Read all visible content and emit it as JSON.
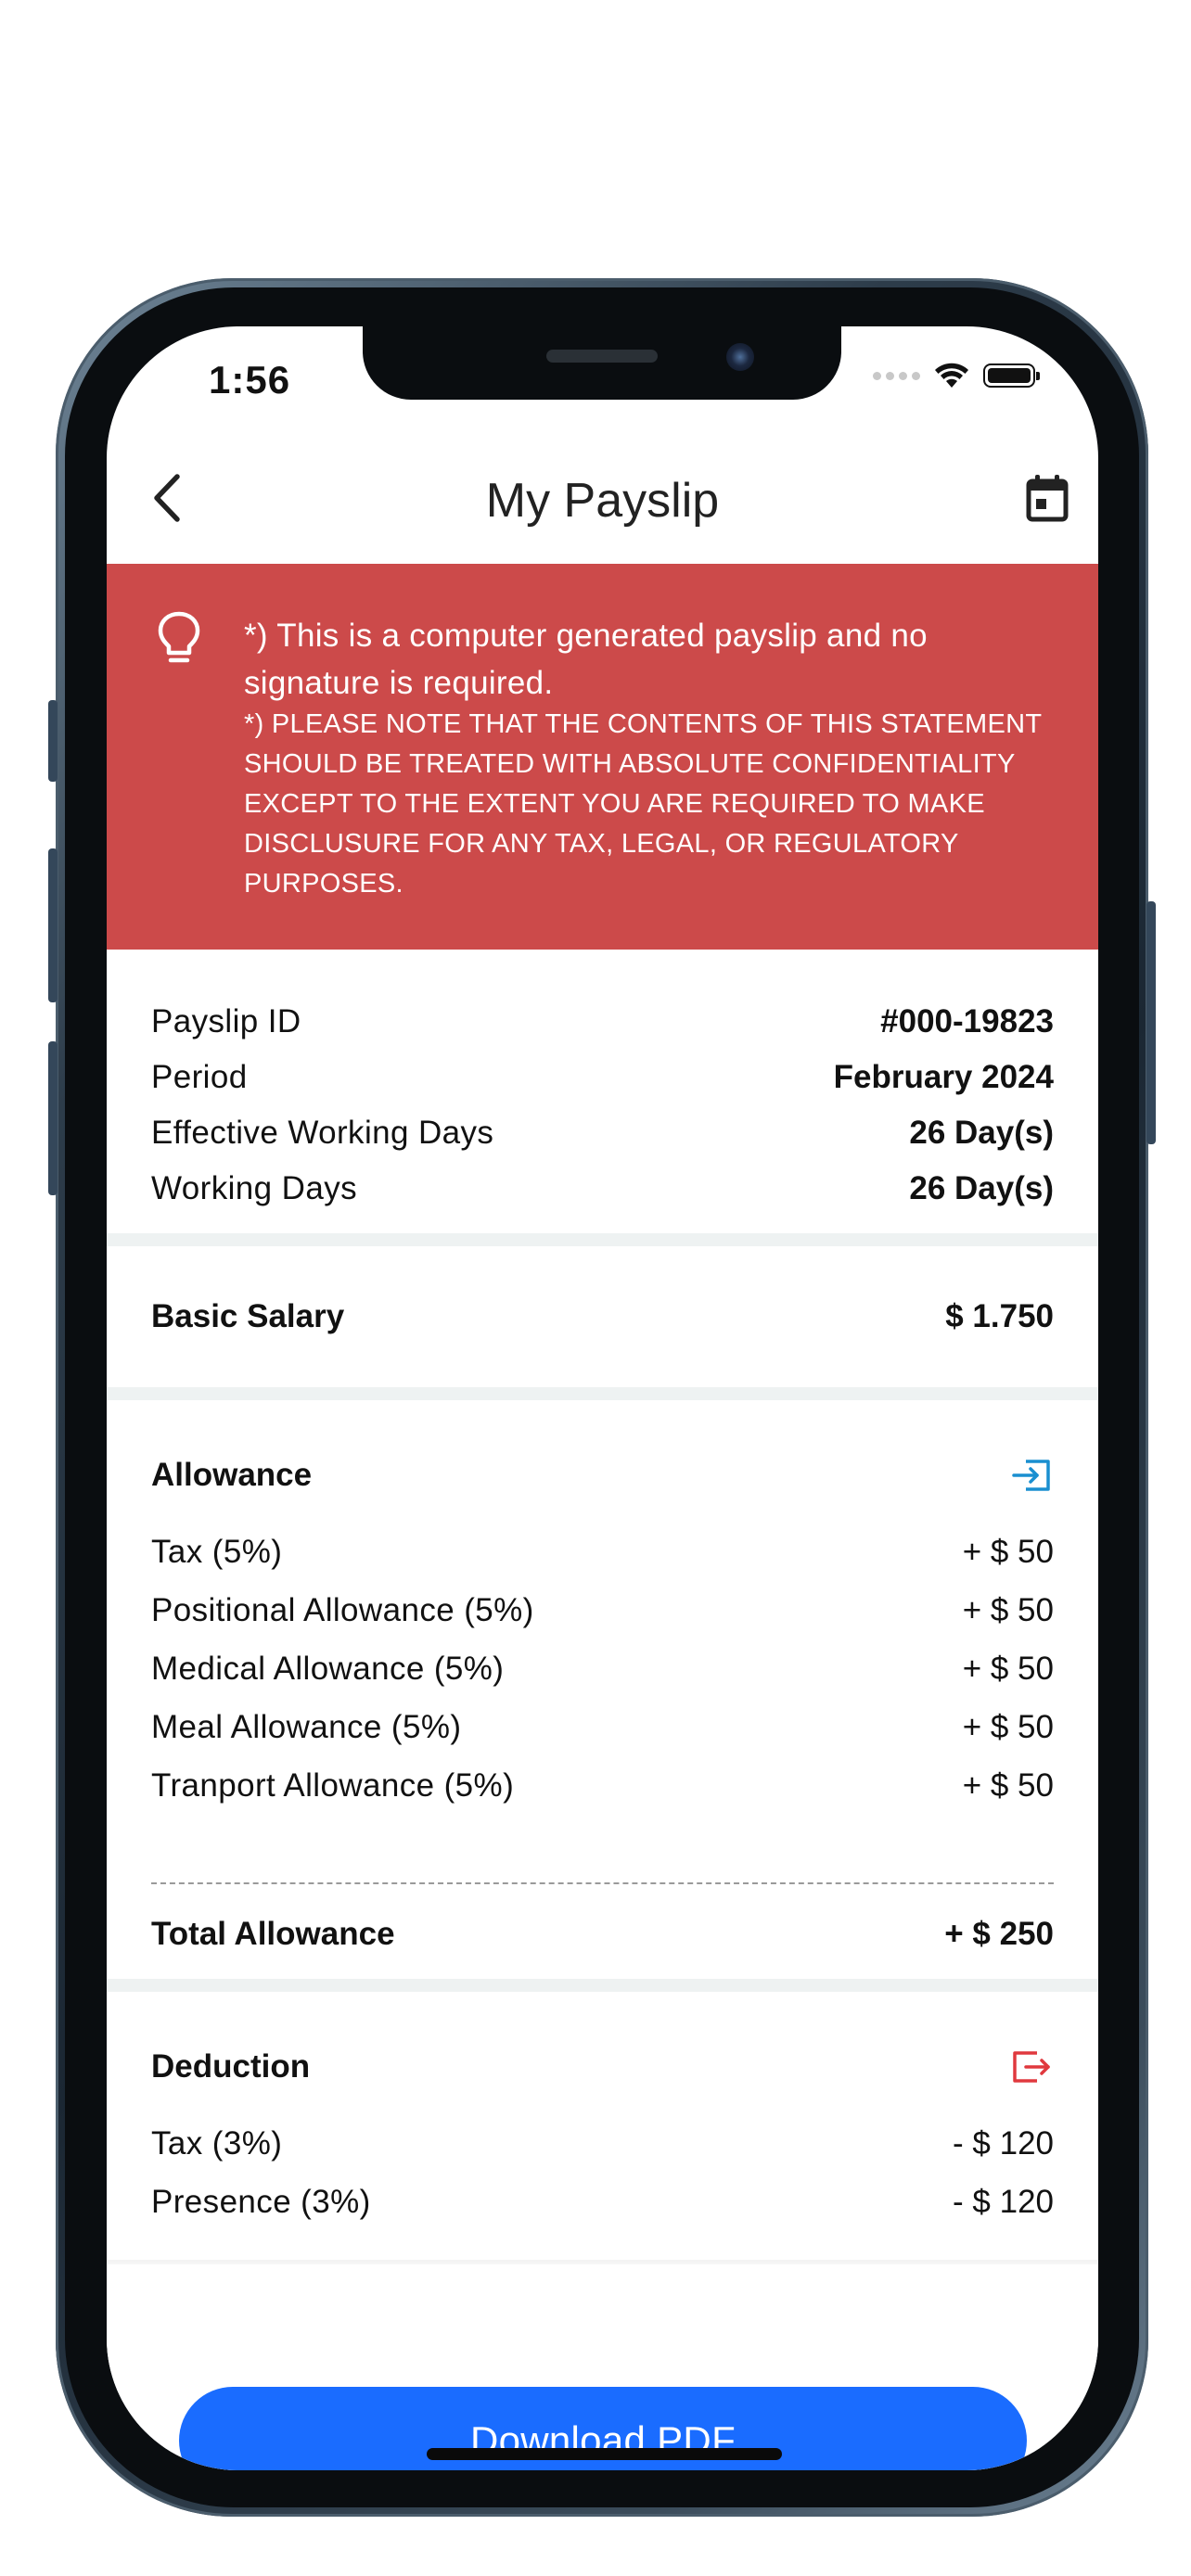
{
  "status_bar": {
    "time": "1:56"
  },
  "header": {
    "title": "My Payslip"
  },
  "notice": {
    "line1": "*) This is a computer generated payslip and no signature is required.",
    "line2": "*) PLEASE NOTE THAT THE CONTENTS OF THIS STATEMENT SHOULD BE TREATED WITH ABSOLUTE CONFIDENTIALITY EXCEPT TO THE EXTENT YOU ARE REQUIRED TO MAKE DISCLUSURE FOR ANY TAX, LEGAL, OR REGULATORY PURPOSES."
  },
  "info": [
    {
      "label": "Payslip ID",
      "value": "#000-19823"
    },
    {
      "label": "Period",
      "value": "February 2024"
    },
    {
      "label": "Effective Working Days",
      "value": "26 Day(s)"
    },
    {
      "label": "Working Days",
      "value": "26 Day(s)"
    }
  ],
  "basic_salary": {
    "label": "Basic Salary",
    "value": "$ 1.750"
  },
  "allowance": {
    "title": "Allowance",
    "items": [
      {
        "label": "Tax (5%)",
        "amount": "+ $ 50"
      },
      {
        "label": "Positional Allowance (5%)",
        "amount": "+ $ 50"
      },
      {
        "label": "Medical Allowance (5%)",
        "amount": "+ $ 50"
      },
      {
        "label": "Meal Allowance (5%)",
        "amount": "+ $ 50"
      },
      {
        "label": "Tranport Allowance (5%)",
        "amount": "+ $ 50"
      }
    ],
    "total_label": "Total Allowance",
    "total_value": "+ $ 250"
  },
  "deduction": {
    "title": "Deduction",
    "items": [
      {
        "label": "Tax (3%)",
        "amount": "- $ 120"
      },
      {
        "label": "Presence (3%)",
        "amount": "- $ 120"
      }
    ]
  },
  "actions": {
    "download_label": "Download PDF"
  },
  "colors": {
    "banner": "#cc4a4a",
    "primary": "#1a6cff",
    "allowance_icon": "#1a8fd0",
    "deduction_icon": "#e0393e"
  },
  "icons": {
    "back": "chevron-left-icon",
    "calendar": "calendar-icon",
    "notice": "lightbulb-icon",
    "allowance": "login-icon",
    "deduction": "logout-icon"
  }
}
